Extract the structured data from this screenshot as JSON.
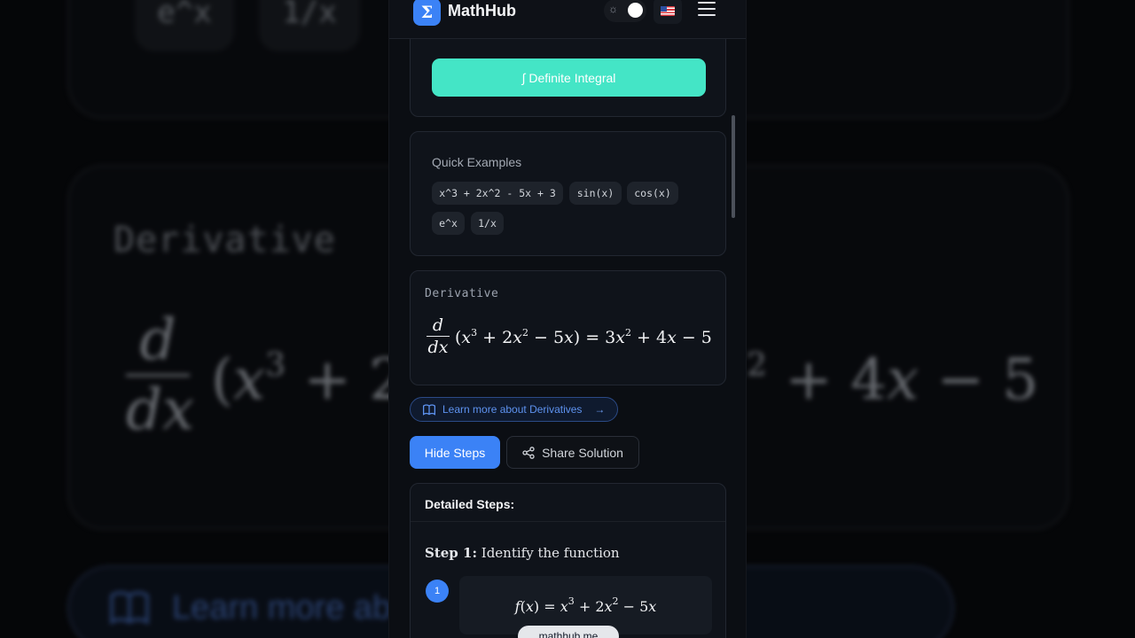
{
  "app": {
    "brand": "MathHub",
    "logo_glyph": "Σ",
    "accent_color": "#3b82f6",
    "integral_button_color": "#44e5c6"
  },
  "header": {
    "theme_icon": "sun-icon",
    "language_flag": "us-flag-icon",
    "menu_icon": "hamburger-menu-icon"
  },
  "integral": {
    "button_label": "∫ Definite Integral"
  },
  "examples": {
    "title": "Quick Examples",
    "items": [
      "x^3 + 2x^2 - 5x + 3",
      "sin(x)",
      "cos(x)",
      "e^x",
      "1/x"
    ]
  },
  "result": {
    "label": "Derivative",
    "frac_num": "d",
    "frac_den": "dx"
  },
  "learn_more": {
    "label": "Learn more about Derivatives",
    "icon": "book-icon",
    "arrow_icon": "arrow-right-icon"
  },
  "actions": {
    "hide_steps": "Hide Steps",
    "share": "Share Solution",
    "share_icon": "share-icon"
  },
  "steps": {
    "title": "Detailed Steps:",
    "items": [
      {
        "number": "1",
        "label": "Step 1:",
        "text": "Identify the function"
      }
    ],
    "source_tag": "mathhub.me"
  },
  "backdrop": {
    "chips": [
      "e^x",
      "1/x"
    ],
    "label": "Derivative",
    "frac_num": "d",
    "frac_den": "dx",
    "pill_text": "Learn more ab"
  }
}
